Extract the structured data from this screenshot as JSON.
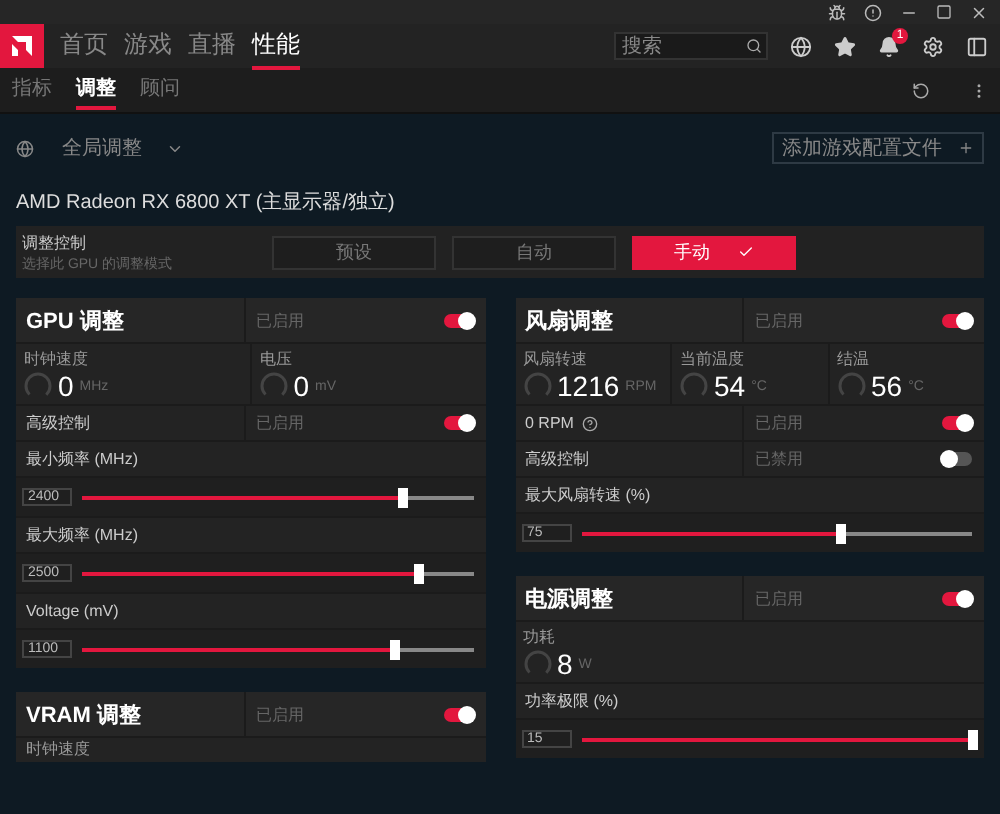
{
  "nav": {
    "tabs": [
      {
        "label": "首页",
        "selected": false
      },
      {
        "label": "游戏",
        "selected": false
      },
      {
        "label": "直播",
        "selected": false
      },
      {
        "label": "性能",
        "selected": true
      }
    ],
    "search": {
      "placeholder": "搜索"
    },
    "notification_badge": "1"
  },
  "subtabs": [
    {
      "label": "指标",
      "selected": false
    },
    {
      "label": "调整",
      "selected": true
    },
    {
      "label": "顾问",
      "selected": false
    }
  ],
  "profile": {
    "label": "全局调整",
    "add_button": "添加游戏配置文件"
  },
  "gpu_name": "AMD Radeon RX 6800 XT (主显示器/独立)",
  "tuning_control": {
    "title": "调整控制",
    "subtitle": "选择此 GPU 的调整模式",
    "modes": [
      {
        "label": "预设",
        "selected": false
      },
      {
        "label": "自动",
        "selected": false
      },
      {
        "label": "手动",
        "selected": true
      }
    ]
  },
  "left_column": [
    {
      "title": "GPU 调整",
      "status": "已启用",
      "on": true,
      "items": [
        {
          "kind": "readings",
          "readings": [
            {
              "label": "时钟速度",
              "value": "0",
              "unit": "MHz"
            },
            {
              "label": "电压",
              "value": "0",
              "unit": "mV"
            }
          ]
        },
        {
          "kind": "toggle",
          "label": "高级控制",
          "status": "已启用",
          "on": true
        },
        {
          "kind": "slider",
          "label": "最小频率 (MHz)",
          "value": "2400",
          "level": 0.82
        },
        {
          "kind": "slider",
          "label": "最大频率 (MHz)",
          "value": "2500",
          "level": 0.86
        },
        {
          "kind": "slider",
          "label": "Voltage (mV)",
          "value": "1100",
          "level": 0.8
        }
      ]
    },
    {
      "title": "VRAM 调整",
      "status": "已启用",
      "on": true,
      "items": [
        {
          "kind": "caption",
          "label": "时钟速度"
        }
      ]
    }
  ],
  "right_column": [
    {
      "title": "风扇调整",
      "status": "已启用",
      "on": true,
      "items": [
        {
          "kind": "readings",
          "readings": [
            {
              "label": "风扇转速",
              "value": "1216",
              "unit": "RPM"
            },
            {
              "label": "当前温度",
              "value": "54",
              "unit": "°C"
            },
            {
              "label": "结温",
              "value": "56",
              "unit": "°C"
            }
          ]
        },
        {
          "kind": "toggle",
          "label": "0 RPM",
          "status": "已启用",
          "on": true,
          "help": true
        },
        {
          "kind": "toggle",
          "label": "高级控制",
          "status": "已禁用",
          "on": false
        },
        {
          "kind": "slider",
          "label": "最大风扇转速 (%)",
          "value": "75",
          "level": 0.66
        }
      ]
    },
    {
      "title": "电源调整",
      "status": "已启用",
      "on": true,
      "items": [
        {
          "kind": "readings",
          "readings": [
            {
              "label": "功耗",
              "value": "8",
              "unit": "W"
            }
          ]
        },
        {
          "kind": "slider",
          "label": "功率极限 (%)",
          "value": "15",
          "level": 1
        }
      ]
    }
  ]
}
